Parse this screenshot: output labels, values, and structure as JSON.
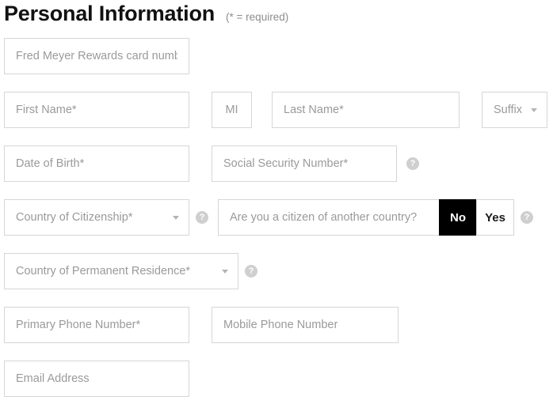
{
  "header": {
    "title": "Personal Information",
    "required_note": "(* = required)"
  },
  "icons": {
    "help": "?",
    "help_name": "help-icon",
    "caret": "chevron-down-icon"
  },
  "form": {
    "rewards_card": {
      "placeholder": "Fred Meyer Rewards card number",
      "value": ""
    },
    "first_name": {
      "placeholder": "First Name*",
      "value": ""
    },
    "middle_initial": {
      "placeholder": "MI",
      "value": ""
    },
    "last_name": {
      "placeholder": "Last Name*",
      "value": ""
    },
    "suffix": {
      "placeholder": "Suffix",
      "value": ""
    },
    "date_of_birth": {
      "placeholder": "Date of Birth*",
      "value": ""
    },
    "social_security_number": {
      "placeholder": "Social Security Number*",
      "value": ""
    },
    "country_of_citizenship": {
      "placeholder": "Country of Citizenship*",
      "value": ""
    },
    "another_country_question": {
      "label": "Are you a citizen of another country?",
      "options": [
        "No",
        "Yes"
      ],
      "selected": "No"
    },
    "country_of_permanent_residence": {
      "placeholder": "Country of Permanent Residence*",
      "value": ""
    },
    "primary_phone": {
      "placeholder": "Primary Phone Number*",
      "value": ""
    },
    "mobile_phone": {
      "placeholder": "Mobile Phone Number",
      "value": ""
    },
    "email": {
      "placeholder": "Email Address",
      "value": ""
    }
  }
}
